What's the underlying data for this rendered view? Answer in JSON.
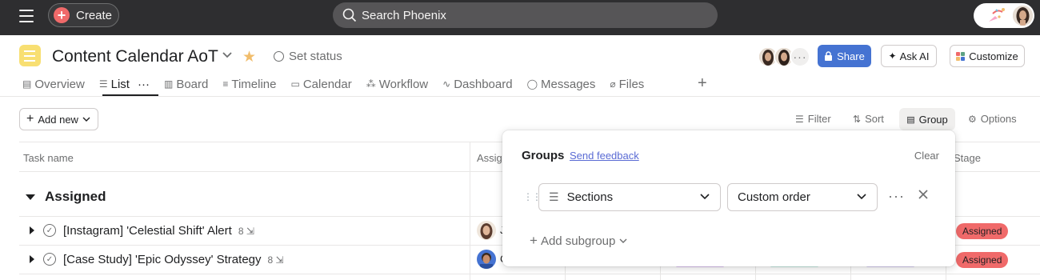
{
  "topbar": {
    "create_label": "Create",
    "search_placeholder": "Search Phoenix"
  },
  "project": {
    "title": "Content Calendar AoT",
    "set_status": "Set status",
    "share_label": "Share",
    "ask_ai_label": "Ask AI",
    "customize_label": "Customize",
    "accent_color": "#f8df72"
  },
  "tabs": [
    {
      "label": "Overview",
      "icon": "overview-icon"
    },
    {
      "label": "List",
      "icon": "list-icon",
      "active": true
    },
    {
      "label": "Board",
      "icon": "board-icon"
    },
    {
      "label": "Timeline",
      "icon": "timeline-icon"
    },
    {
      "label": "Calendar",
      "icon": "calendar-icon"
    },
    {
      "label": "Workflow",
      "icon": "workflow-icon"
    },
    {
      "label": "Dashboard",
      "icon": "dashboard-icon"
    },
    {
      "label": "Messages",
      "icon": "messages-icon"
    },
    {
      "label": "Files",
      "icon": "files-icon"
    }
  ],
  "toolbar": {
    "add_new": "Add new",
    "filter": "Filter",
    "sort": "Sort",
    "group": "Group",
    "options": "Options"
  },
  "table": {
    "col_task": "Task name",
    "col_assignee": "Assig",
    "col_stage": "Stage",
    "section": "Assigned",
    "rows": [
      {
        "name": "[Instagram] 'Celestial Shift' Alert",
        "subtasks": "8",
        "assignee_initial": "J",
        "stage": "Assigned"
      },
      {
        "name": "[Case Study] 'Epic Odyssey' Strategy",
        "subtasks": "8",
        "assignee_initial": "C",
        "stage": "Assigned"
      }
    ],
    "stage_color": "#f06a6a"
  },
  "groups_popover": {
    "title": "Groups",
    "feedback": "Send feedback",
    "clear": "Clear",
    "group_by": "Sections",
    "order": "Custom order",
    "add_subgroup": "Add subgroup"
  }
}
